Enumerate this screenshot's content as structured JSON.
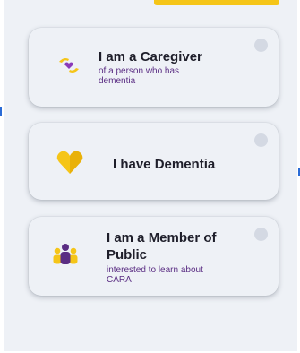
{
  "colors": {
    "accent_yellow": "#f5c518",
    "subtitle_purple": "#5a2d83",
    "radio_gray": "#d4d9e3",
    "background": "#eef1f6"
  },
  "options": [
    {
      "title": "I am a Caregiver",
      "subtitle": "of a person who has dementia",
      "icon": "caring-hands-heart-icon"
    },
    {
      "title": "I have Dementia",
      "subtitle": "",
      "icon": "yellow-heart-icon"
    },
    {
      "title": "I am a Member of Public",
      "subtitle": "interested to learn about CARA",
      "icon": "people-group-icon"
    }
  ]
}
